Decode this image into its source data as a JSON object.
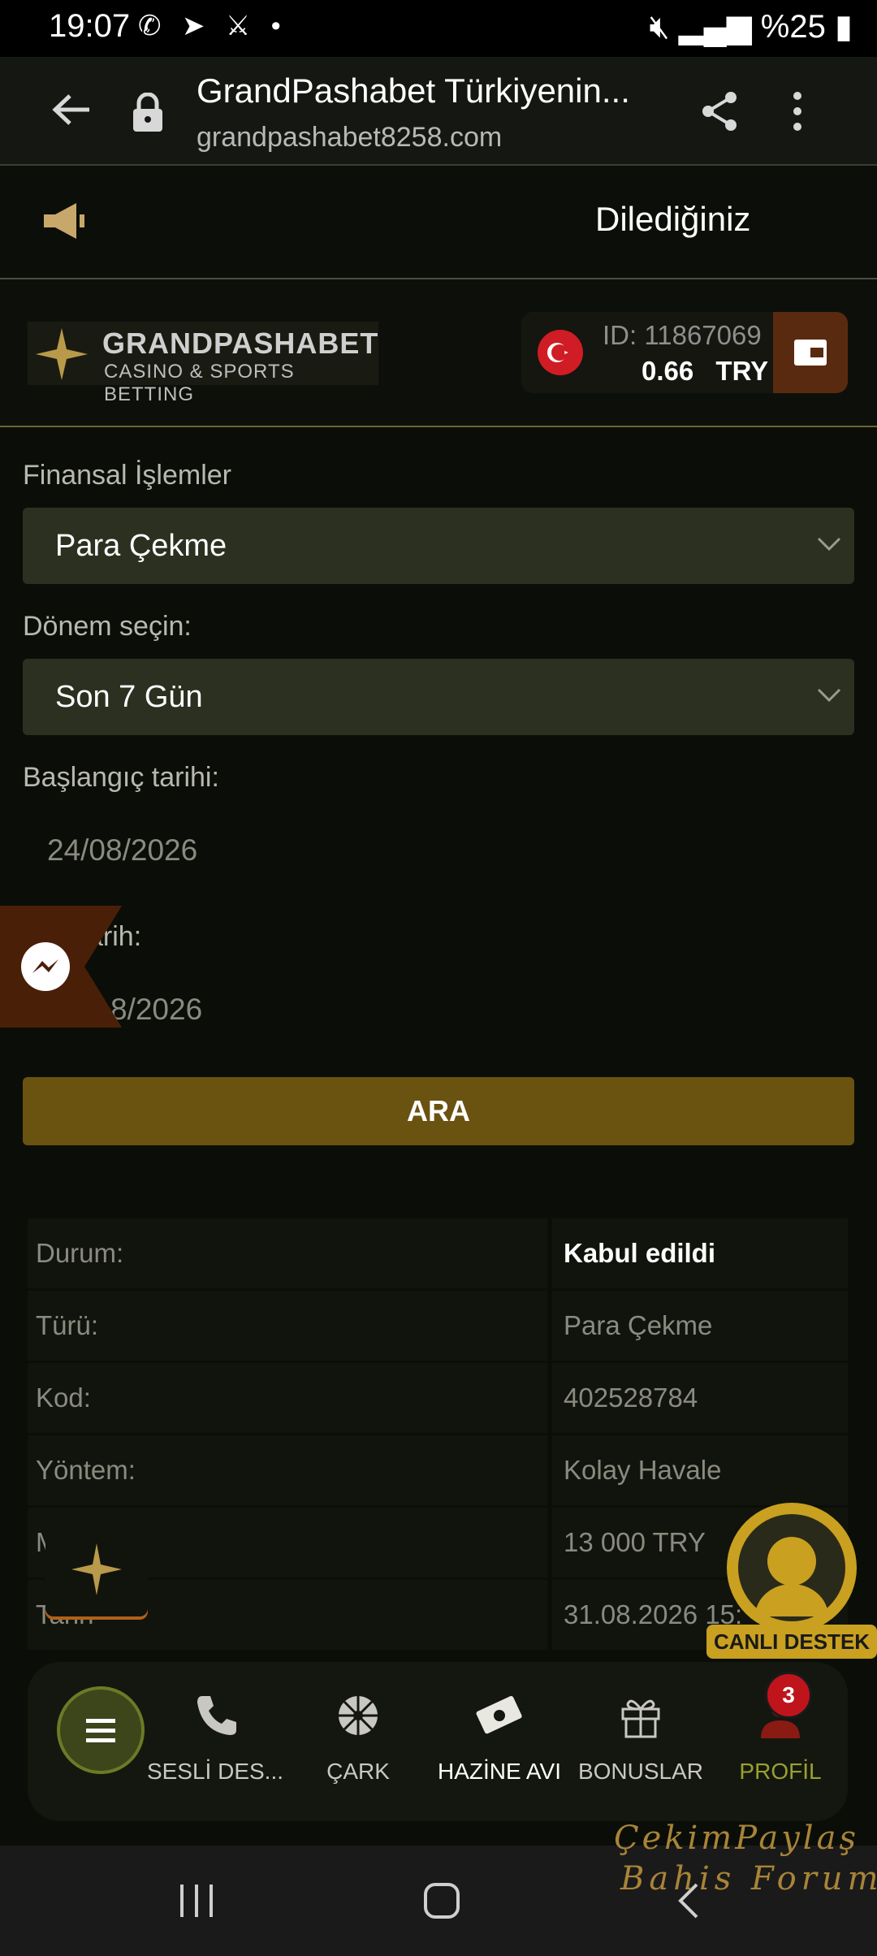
{
  "status_bar": {
    "time": "19:07",
    "battery": "%25"
  },
  "browser": {
    "title": "GrandPashabet Türkiyenin...",
    "url": "grandpashabet8258.com"
  },
  "announcement": {
    "text": "Dilediğiniz"
  },
  "header": {
    "logo_brand": "GRANDPASHABET",
    "logo_sub": "CASINO & SPORTS BETTING",
    "user_id": "ID: 11867069",
    "balance": "0.66",
    "currency": "TRY"
  },
  "form": {
    "financial_label": "Finansal İşlemler",
    "financial_value": "Para Çekme",
    "period_label": "Dönem seçin:",
    "period_value": "Son 7 Gün",
    "start_label": "Başlangıç tarihi:",
    "start_value": "24/08/2026",
    "end_label": "arih:",
    "end_value": "8/2026",
    "search_button": "ARA"
  },
  "details": [
    {
      "key": "Durum:",
      "value": "Kabul edildi"
    },
    {
      "key": "Türü:",
      "value": "Para Çekme"
    },
    {
      "key": "Kod:",
      "value": "402528784"
    },
    {
      "key": "Yöntem:",
      "value": "Kolay Havale"
    },
    {
      "key": "M",
      "value": "13 000 TRY"
    },
    {
      "key": "Tarih",
      "value": "31.08.2026 15:"
    }
  ],
  "support": {
    "label": "CANLI DESTEK"
  },
  "bottom_nav": {
    "items": [
      {
        "label": "SESLİ DES..."
      },
      {
        "label": "ÇARK"
      },
      {
        "label": "HAZİNE AVI"
      },
      {
        "label": "BONUSLAR"
      },
      {
        "label": "PROFİL"
      }
    ],
    "badge": "3"
  },
  "watermark": {
    "line1": "ÇekimPaylaş",
    "line2": "Bahis Forum"
  },
  "colors": {
    "accent": "#6a5210",
    "profile": "#9aa030",
    "select_bg": "#2c3020"
  }
}
